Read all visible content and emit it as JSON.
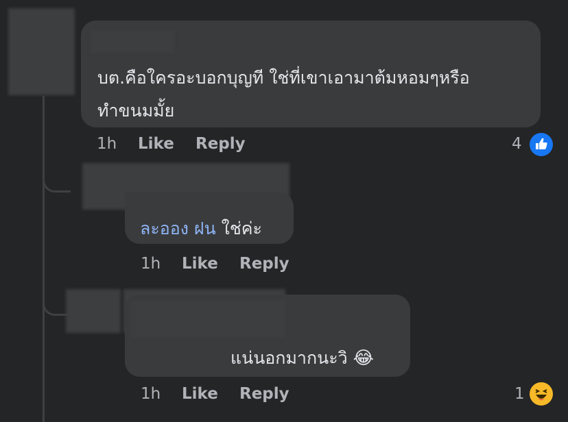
{
  "comments": [
    {
      "text": "บต.คือใครอะบอกบุญที ใช่ที่เขาเอามาต้มหอมๆหรือ",
      "text2": "ทำขนมมั้ย",
      "time": "1h",
      "like": "Like",
      "reply": "Reply",
      "reaction_count": "4",
      "reaction_icon": "like-icon"
    },
    {
      "mention": "ละออง ฝน",
      "text": "ใช่ค่ะ",
      "time": "1h",
      "like": "Like",
      "reply": "Reply"
    },
    {
      "text": "แน่นอกมากนะวิ",
      "emoji": "😂",
      "time": "1h",
      "like": "Like",
      "reply": "Reply",
      "reaction_count": "1",
      "reaction_icon": "haha-icon"
    }
  ],
  "colors": {
    "background": "#242526",
    "bubble": "#3a3b3c",
    "meta": "#b0b3b8",
    "mention": "#8eb4f6",
    "like_blue": "#1877f2",
    "haha_yellow": "#f7b928"
  }
}
